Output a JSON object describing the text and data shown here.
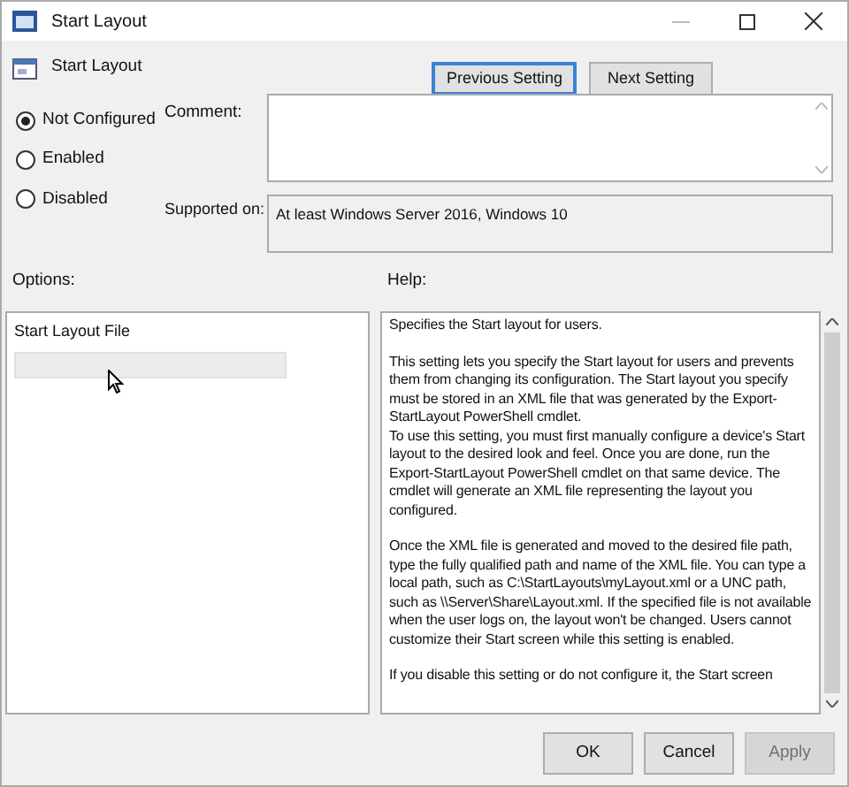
{
  "window": {
    "title": "Start Layout"
  },
  "setting_name": "Start Layout",
  "nav_buttons": [
    {
      "label": "Previous Setting",
      "focused": true
    },
    {
      "label": "Next Setting",
      "focused": false
    }
  ],
  "radios": [
    {
      "label": "Not Configured",
      "selected": true
    },
    {
      "label": "Enabled",
      "selected": false
    },
    {
      "label": "Disabled",
      "selected": false
    }
  ],
  "comment": {
    "label": "Comment:"
  },
  "supported_on": {
    "label": "Supported on:",
    "value": "At least Windows Server 2016, Windows 10"
  },
  "options": {
    "label": "Options:",
    "field_label": "Start Layout File"
  },
  "help": {
    "label": "Help:",
    "blocks": [
      [
        "Specifies the Start layout for users."
      ],
      [
        "This setting lets you specify the Start layout for users and prevents them from changing its configuration. The Start layout you specify must be stored in an XML file that was generated by the Export-StartLayout PowerShell cmdlet.",
        "To use this setting, you must first manually configure a device's Start layout to the desired look and feel. Once you are done, run the Export-StartLayout PowerShell cmdlet on that same device. The cmdlet will generate an XML file representing the layout you configured."
      ],
      [
        "Once the XML file is generated and moved to the desired file path, type the fully qualified path and name of the XML file. You can type a local path, such as C:\\StartLayouts\\myLayout.xml or a UNC path, such as \\\\Server\\Share\\Layout.xml. If the specified file is not available when the user logs on, the layout won't be changed. Users cannot customize their Start screen while this setting is enabled."
      ],
      [
        "If you disable this setting or do not configure it, the Start screen"
      ]
    ]
  },
  "footer_buttons": [
    {
      "label": "OK",
      "disabled": false
    },
    {
      "label": "Cancel",
      "disabled": false
    },
    {
      "label": "Apply",
      "disabled": true
    }
  ]
}
